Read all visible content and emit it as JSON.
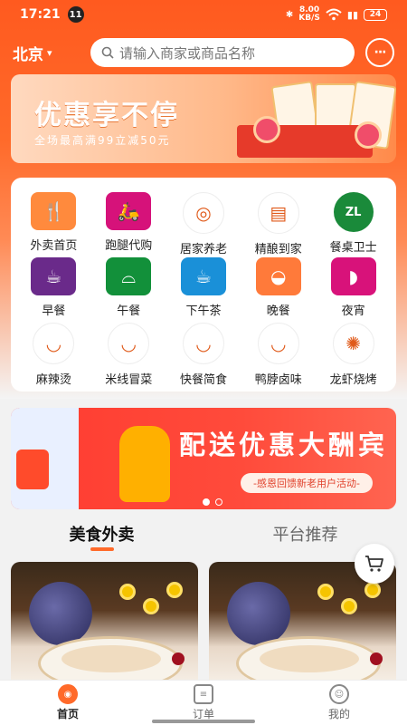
{
  "status_bar": {
    "time": "17:21",
    "notification_count": "11",
    "net_speed_value": "8.00",
    "net_speed_unit": "KB/S",
    "battery": "24"
  },
  "header": {
    "city": "北京",
    "search_placeholder": "请输入商家或商品名称"
  },
  "promo_banner": {
    "title": "优惠享不停",
    "subtitle": "全场最高满99立减50元"
  },
  "categories": [
    {
      "label": "外卖首页",
      "icon": "fork-knife-icon",
      "color": "#ff8a3d"
    },
    {
      "label": "跑腿代购",
      "icon": "scooter-icon",
      "color": "#d6127a"
    },
    {
      "label": "居家养老",
      "icon": "elderly-care-logo-icon",
      "color": "#ffffff"
    },
    {
      "label": "精酿到家",
      "icon": "craft-beer-logo-icon",
      "color": "#ffffff"
    },
    {
      "label": "餐桌卫士",
      "icon": "zl-logo-icon",
      "color": "#1a8a3a"
    },
    {
      "label": "早餐",
      "icon": "breakfast-icon",
      "color": "#6a2a8a"
    },
    {
      "label": "午餐",
      "icon": "cloche-icon",
      "color": "#12903a"
    },
    {
      "label": "下午茶",
      "icon": "teacup-icon",
      "color": "#1a90d8"
    },
    {
      "label": "晚餐",
      "icon": "pot-icon",
      "color": "#ff7a3a"
    },
    {
      "label": "夜宵",
      "icon": "shrimp-icon",
      "color": "#d8127a"
    },
    {
      "label": "麻辣烫",
      "icon": "malatang-bowl-icon",
      "color": "#ffffff"
    },
    {
      "label": "米线冒菜",
      "icon": "noodle-bowl-icon",
      "color": "#ffffff"
    },
    {
      "label": "快餐简食",
      "icon": "fastfood-bowl-icon",
      "color": "#ffffff"
    },
    {
      "label": "鸭脖卤味",
      "icon": "duck-neck-icon",
      "color": "#ffffff"
    },
    {
      "label": "龙虾烧烤",
      "icon": "crayfish-icon",
      "color": "#ffffff"
    }
  ],
  "delivery_banner": {
    "title": "配送优惠大酬宾",
    "subtitle": "-感恩回馈新老用户活动-"
  },
  "tabs": [
    {
      "label": "美食外卖",
      "active": true
    },
    {
      "label": "平台推荐",
      "active": false
    }
  ],
  "bottom_nav": [
    {
      "label": "首页",
      "icon": "home-icon",
      "active": true
    },
    {
      "label": "订单",
      "icon": "orders-icon",
      "active": false
    },
    {
      "label": "我的",
      "icon": "profile-icon",
      "active": false
    }
  ],
  "colors": {
    "brand": "#ff6a2a",
    "banner_red": "#ff3b30"
  }
}
